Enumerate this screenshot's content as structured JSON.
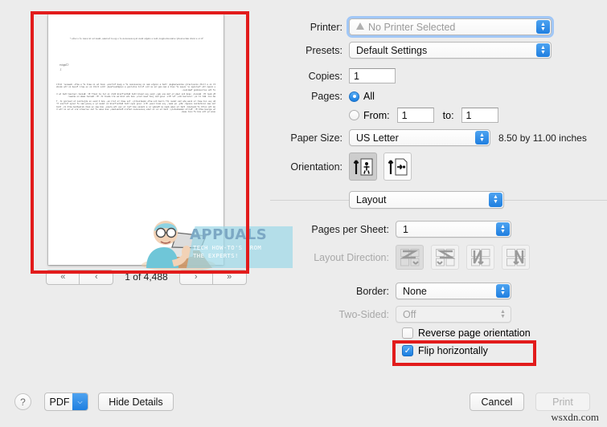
{
  "preview": {
    "document_header": "“It is a truth universally acknowledged, that a single man in possession of a good fortune, must be in want of a wife.”",
    "document_right_line1": "Chapter",
    "document_right_line2": "1.",
    "paragraphs": [
      "It is a truth universally acknowledged, that a single man in possession of a good fortune, must be in want of a wife. However little known the feelings or views of such a man may be on his first entering a neighbourhood, this truth is so well fixed in the minds of the surrounding families.",
      "My dear Mr. Bennet, said his lady to him one day, have you heard that Netherfield Park is let at last? Mr. Bennet replied that he had not. But it is, returned she; for Mrs. Long has just been here, and she told me all about it. Mr. Bennet made no answer.",
      "Do you not want to know who has taken it? cried his wife impatiently. You want to tell me, and I have no objection to hearing it. This was invitation enough. Why, my dear, you must know, Mrs. Long says that Netherfield is taken by a young man of large fortune from the north of England; that he came down on Monday in a chaise and four to see the place, and was so much delighted with it, that he agreed with Mr. Morris immediately; that he is to take possession before Michaelmas, and some of his servants are to be in the house by the end of next week."
    ],
    "nav": {
      "first_label": "«",
      "prev_label": "‹",
      "next_label": "›",
      "last_label": "»",
      "page_count_label": "1 of 4,488"
    },
    "watermark": {
      "title": "APPUALS",
      "subtitle_line1": "TECH HOW-TO'S FROM",
      "subtitle_line2": "THE EXPERTS!"
    }
  },
  "settings": {
    "printer": {
      "label": "Printer:",
      "value": "No Printer Selected",
      "has_warning_icon": true
    },
    "presets": {
      "label": "Presets:",
      "value": "Default Settings"
    },
    "copies": {
      "label": "Copies:",
      "value": "1"
    },
    "pages": {
      "label": "Pages:",
      "all_label": "All",
      "all_selected": true,
      "from_label": "From:",
      "from_value": "1",
      "to_label": "to:",
      "to_value": "1"
    },
    "paper_size": {
      "label": "Paper Size:",
      "value": "US Letter",
      "dimensions": "8.50 by 11.00 inches"
    },
    "orientation": {
      "label": "Orientation:",
      "portrait_selected": true,
      "landscape_selected": false
    },
    "pane": {
      "value": "Layout"
    },
    "pages_per_sheet": {
      "label": "Pages per Sheet:",
      "value": "1"
    },
    "layout_direction": {
      "label": "Layout Direction:",
      "selected_index": 0,
      "disabled": true
    },
    "border": {
      "label": "Border:",
      "value": "None"
    },
    "two_sided": {
      "label": "Two-Sided:",
      "value": "Off",
      "disabled": true
    },
    "reverse_page_orientation": {
      "label": "Reverse page orientation",
      "checked": false
    },
    "flip_horizontally": {
      "label": "Flip horizontally",
      "checked": true,
      "check_glyph": "✓"
    }
  },
  "bottom": {
    "help_label": "?",
    "pdf_label": "PDF",
    "pdf_arrow": "⌵",
    "hide_details_label": "Hide Details",
    "cancel_label": "Cancel",
    "print_label": "Print",
    "print_disabled": true
  },
  "site_watermark": "wsxdn.com",
  "colors": {
    "accent_blue": "#1f7fe0",
    "annotation_red": "#e21b1b",
    "dialog_bg": "#ececec"
  }
}
